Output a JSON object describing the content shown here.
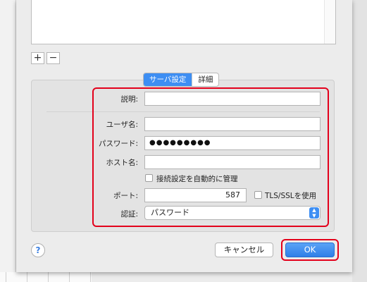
{
  "list_buttons": {
    "add": "+",
    "remove": "−"
  },
  "tabs": [
    {
      "label": "サーバ設定",
      "active": true
    },
    {
      "label": "詳細",
      "active": false
    }
  ],
  "form": {
    "description": {
      "label": "説明:",
      "value": ""
    },
    "username": {
      "label": "ユーザ名:",
      "value": ""
    },
    "password": {
      "label": "パスワード:",
      "value": "●●●●●●●●●"
    },
    "host": {
      "label": "ホスト名:",
      "value": ""
    },
    "auto_manage": {
      "label": "接続設定を自動的に管理",
      "checked": false
    },
    "port": {
      "label": "ポート:",
      "value": "587"
    },
    "tls": {
      "label": "TLS/SSLを使用",
      "checked": false
    },
    "auth": {
      "label": "認証:",
      "value": "パスワード"
    }
  },
  "footer": {
    "help": "?",
    "cancel": "キャンセル",
    "ok": "OK"
  },
  "colors": {
    "accent": "#3d8ef3",
    "highlight": "#e3001b"
  }
}
